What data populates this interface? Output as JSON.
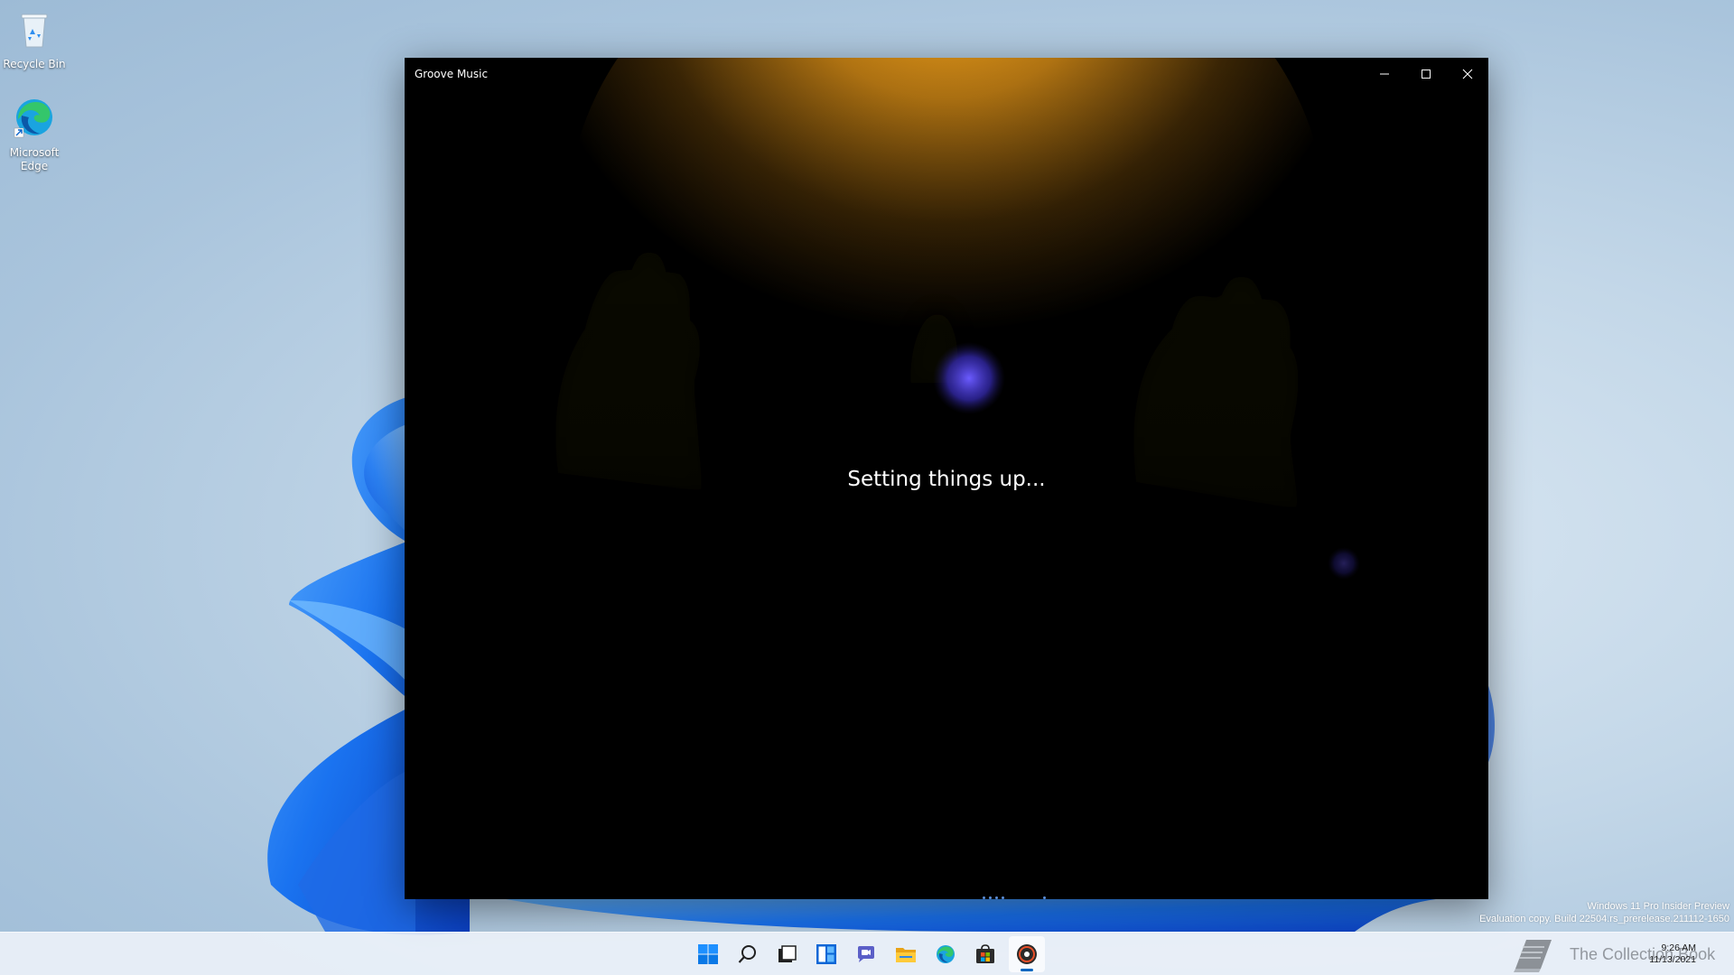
{
  "desktop": {
    "icons": [
      {
        "label": "Recycle Bin"
      },
      {
        "label": "Microsoft Edge"
      }
    ],
    "watermark": {
      "line1": "Windows 11 Pro Insider Preview",
      "line2": "Evaluation copy. Build 22504.rs_prerelease.211112-1650"
    }
  },
  "window": {
    "title": "Groove Music",
    "status": "Setting things up...",
    "colors": {
      "glow": "#f0a21c",
      "accent_light": "#6b5bff"
    }
  },
  "taskbar": {
    "items": [
      "start-icon",
      "search-icon",
      "task-view-icon",
      "widgets-icon",
      "chat-icon",
      "file-explorer-icon",
      "edge-icon",
      "store-icon",
      "groove-music-icon"
    ],
    "active_item": "groove-music-icon",
    "clock": {
      "time": "9:26 AM",
      "date": "11/13/2021"
    },
    "brand_logo_text": "The Collection Book"
  }
}
